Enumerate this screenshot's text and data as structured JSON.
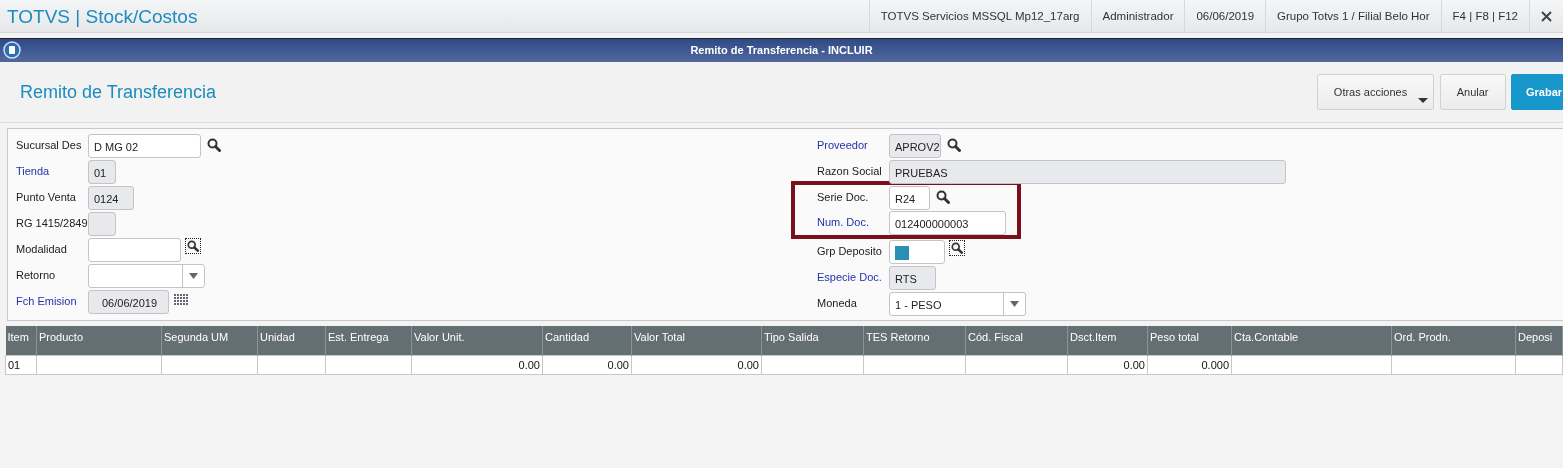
{
  "app_bar": {
    "title": "TOTVS | Stock/Costos",
    "info": [
      "TOTVS Servicios MSSQL Mp12_17arg",
      "Administrador",
      "06/06/2019",
      "Grupo Totvs 1 / Filial Belo Hor",
      "F4 | F8 | F12"
    ]
  },
  "window": {
    "title": "Remito de Transferencia - INCLUIR"
  },
  "header": {
    "title": "Remito de Transferencia",
    "buttons": [
      {
        "label": "Otras acciones",
        "kind": "menu"
      },
      {
        "label": "Anular",
        "kind": "default"
      },
      {
        "label": "Grabar",
        "kind": "primary"
      }
    ]
  },
  "form": {
    "left": [
      {
        "label": "Sucursal Des",
        "required": false,
        "kind": "text",
        "value": "D MG 02",
        "lookup": true,
        "focused": false,
        "highlighted": false
      },
      {
        "label": "Tienda",
        "required": true,
        "kind": "readonly",
        "value": "01",
        "highlighted": false
      },
      {
        "label": "Punto Venta",
        "required": false,
        "kind": "readonly",
        "value": "0124",
        "highlighted": false
      },
      {
        "label": "RG 1415/2849",
        "required": false,
        "kind": "readonly",
        "highlighted": false
      },
      {
        "label": "Modalidad",
        "required": false,
        "kind": "text",
        "lookup": true,
        "focused": true,
        "highlighted": false
      },
      {
        "label": "Retorno",
        "required": false,
        "kind": "select",
        "highlighted": false
      },
      {
        "label": "Fch Emision",
        "required": true,
        "kind": "date",
        "value": "06/06/2019",
        "highlighted": false
      }
    ],
    "right": [
      {
        "label": "Proveedor",
        "required": true,
        "kind": "readonly",
        "value": "APROV2",
        "lookup": true,
        "focused": false,
        "highlighted": false
      },
      {
        "label": "Razon Social",
        "required": false,
        "kind": "readonly",
        "value": "PRUEBAS",
        "highlighted": false
      },
      {
        "label": "Serie Doc.",
        "required": false,
        "kind": "text",
        "value": "R24",
        "lookup": true,
        "focused": false,
        "highlighted": true
      },
      {
        "label": "Num. Doc.",
        "required": true,
        "kind": "text",
        "value": "012400000003",
        "highlighted": true
      },
      {
        "label": "Grp Deposito",
        "required": false,
        "kind": "color",
        "color": "#2a8fb0",
        "lookup": true,
        "focused": true,
        "highlighted": false
      },
      {
        "label": "Especie Doc.",
        "required": true,
        "kind": "readonly",
        "value": "RTS",
        "highlighted": false
      },
      {
        "label": "Moneda",
        "required": false,
        "kind": "select",
        "value": "1 - PESO",
        "highlighted": false
      }
    ]
  },
  "table": {
    "columns": [
      {
        "label": "Item",
        "numeric": false
      },
      {
        "label": "Producto"
      },
      {
        "label": "Segunda UM"
      },
      {
        "label": "Unidad"
      },
      {
        "label": "Est. Entrega"
      },
      {
        "label": "Valor Unit.",
        "numeric": true
      },
      {
        "label": "Cantidad",
        "numeric": true
      },
      {
        "label": "Valor Total",
        "numeric": true
      },
      {
        "label": "Tipo Salida"
      },
      {
        "label": "TES Retorno"
      },
      {
        "label": "Cód. Fiscal"
      },
      {
        "label": "Dsct.Item",
        "numeric": true
      },
      {
        "label": "Peso total",
        "numeric": true
      },
      {
        "label": "Cta.Contable"
      },
      {
        "label": "Ord. Prodn."
      },
      {
        "label": "Deposi"
      }
    ],
    "rows": [
      [
        "01",
        "",
        "",
        "",
        "",
        "0.00",
        "0.00",
        "0.00",
        "",
        "",
        "",
        "0.00",
        "0.000",
        "",
        "",
        ""
      ]
    ]
  }
}
